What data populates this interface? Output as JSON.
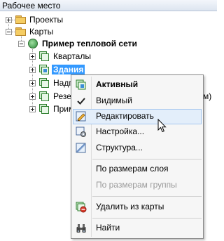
{
  "panel": {
    "title": "Рабочее место"
  },
  "tree": {
    "projects_label": "Проекты",
    "maps_label": "Карты",
    "map_name": "Пример тепловой сети",
    "layers": [
      {
        "label": "Кварталы"
      },
      {
        "label": "Здания"
      },
      {
        "label": "Надп"
      },
      {
        "label": "Резе"
      },
      {
        "label": "Прим"
      }
    ],
    "truncated_tail": "м)"
  },
  "context_menu": {
    "items": [
      {
        "label": "Активный",
        "icon": "active-layer-icon"
      },
      {
        "label": "Видимый",
        "icon": "checkmark-icon"
      },
      {
        "label": "Редактировать",
        "icon": "edit-icon"
      },
      {
        "label": "Настройка...",
        "icon": "settings-icon"
      },
      {
        "label": "Структура...",
        "icon": "structure-icon"
      },
      {
        "label": "По размерам слоя",
        "icon": ""
      },
      {
        "label": "По размерам группы",
        "icon": ""
      },
      {
        "label": "Удалить из карты",
        "icon": "remove-from-map-icon"
      },
      {
        "label": "Найти",
        "icon": "binoculars-icon"
      }
    ]
  }
}
